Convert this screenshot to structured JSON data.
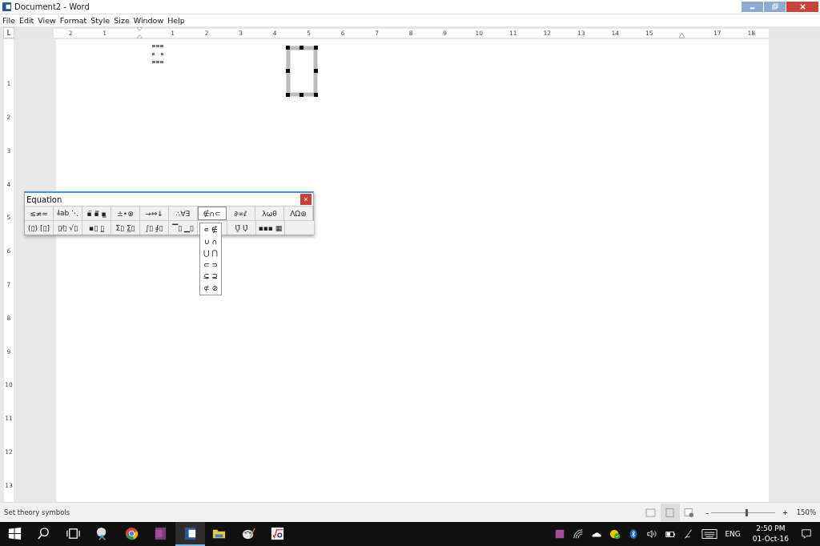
{
  "window": {
    "title": "Document2 - Word"
  },
  "menu": [
    "File",
    "Edit",
    "View",
    "Format",
    "Style",
    "Size",
    "Window",
    "Help"
  ],
  "ruler": {
    "corner": "L",
    "horizontal": [
      "2",
      "1",
      "1",
      "2",
      "3",
      "4",
      "5",
      "6",
      "7",
      "8",
      "9",
      "10",
      "11",
      "12",
      "13",
      "14",
      "15",
      "17",
      "18"
    ],
    "vertical": [
      "1",
      "2",
      "3",
      "4",
      "5",
      "6",
      "7",
      "8",
      "9",
      "10",
      "11",
      "12",
      "13"
    ]
  },
  "equation_palette": {
    "title": "Equation",
    "close": "×",
    "row_1": [
      {
        "label": "≤≠≈",
        "selected": false
      },
      {
        "label": "⫰ab ⋱",
        "selected": false
      },
      {
        "label": "▪̈ ▪̿ ▪̳",
        "selected": false
      },
      {
        "label": "±•⊗",
        "selected": false
      },
      {
        "label": "→⇔↓",
        "selected": false
      },
      {
        "label": "∴∀∃",
        "selected": false
      },
      {
        "label": "∉∩⊂",
        "selected": true
      },
      {
        "label": "∂∞ℓ",
        "selected": false
      },
      {
        "label": "λωθ",
        "selected": false
      },
      {
        "label": "ΛΩ⊛",
        "selected": false
      }
    ],
    "row_2": [
      "(▯) [▯]",
      "▯⁄▯ √▯",
      "▪▯ ▯̲",
      "Σ▯ Σ̲▯",
      "∫▯ ∮▯",
      "▔▯ ▁▯",
      "Ṵ̈ Ụ̇",
      "▪▪▪ ▦"
    ],
    "dropdown": [
      "∊ ∉",
      "∪ ∩",
      "⋃ ⋂",
      "⊂ ⊃",
      "⊆ ⊇",
      "⊄ ⊘"
    ]
  },
  "status_bar": {
    "text": "Set theory symbols",
    "views": [
      {
        "kind": "read",
        "selected": false
      },
      {
        "kind": "print",
        "selected": true
      },
      {
        "kind": "web",
        "selected": false
      }
    ],
    "zoom": {
      "minus": "-",
      "plus": "+",
      "level": 0.53,
      "reading": "150%"
    }
  },
  "taskbar": {
    "apps": [
      {
        "kind": "start",
        "selected": false
      },
      {
        "kind": "search",
        "selected": false
      },
      {
        "kind": "taskview",
        "selected": false
      },
      {
        "kind": "snip",
        "selected": false
      },
      {
        "kind": "chrome",
        "selected": false
      },
      {
        "kind": "onenote",
        "selected": false
      },
      {
        "kind": "word",
        "selected": true
      },
      {
        "kind": "folder",
        "selected": false
      },
      {
        "kind": "paint",
        "selected": false
      },
      {
        "kind": "equation",
        "selected": false
      }
    ],
    "tray": {
      "language": "ENG",
      "time": "2:50 PM",
      "date": "01-Oct-16"
    }
  }
}
